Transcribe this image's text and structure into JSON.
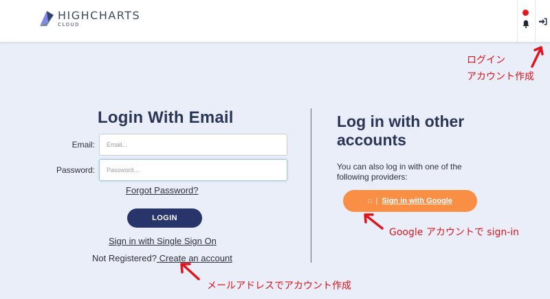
{
  "header": {
    "logo_title": "HIGHCHARTS",
    "logo_subtitle": "CLOUD",
    "notification_icon": "bell-icon",
    "notification_dot_color": "#e0191b",
    "login_icon": "sign-in-icon"
  },
  "email_login": {
    "title": "Login With Email",
    "email_label": "Email:",
    "email_placeholder": "Email...",
    "password_label": "Password:",
    "password_placeholder": "Password...",
    "forgot_link": "Forgot Password?",
    "login_button": "LOGIN",
    "sso_link": "Sign in with Single Sign On",
    "not_registered_text": "Not Registered?",
    "create_account_link": " Create an account"
  },
  "other_login": {
    "title": "Log in with other accounts",
    "description": "You can also log in with one of the following providers:",
    "google_icon": "google-icon",
    "google_icon_glyph": "□",
    "google_separator": "|",
    "google_button": "Sign in with Google"
  },
  "annotations": {
    "login_note_line1": "ログイン",
    "login_note_line2": "アカウント作成",
    "google_note": "Google アカウントで sign-in",
    "mail_note": "メールアドレスでアカウント作成",
    "annotation_color": "#e1131b"
  },
  "colors": {
    "primary_button": "#27356b",
    "google_button": "#f98f45",
    "page_background": "#e9eef8"
  }
}
